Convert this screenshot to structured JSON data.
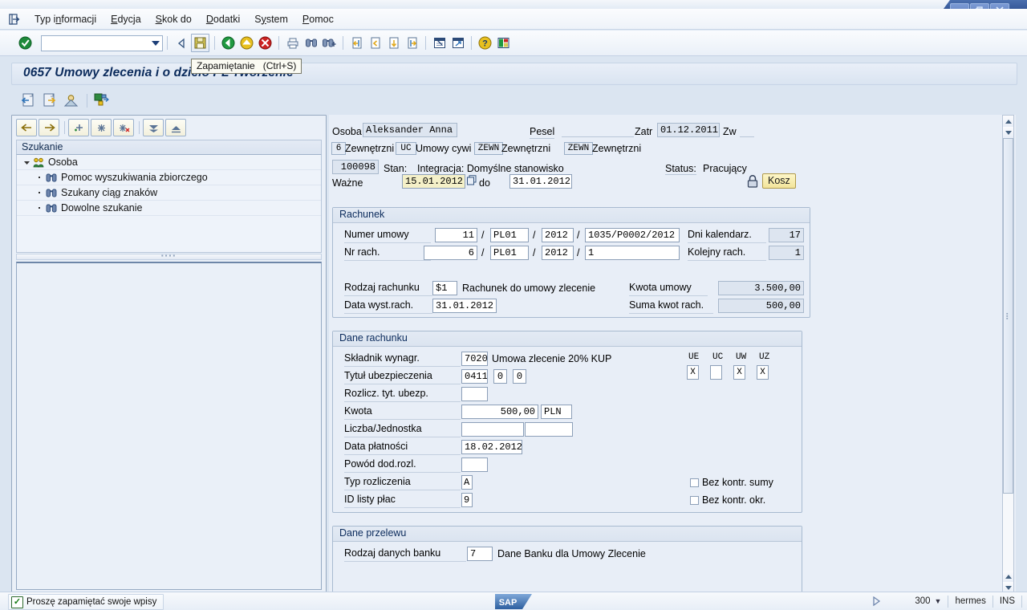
{
  "window": {
    "buttons": [
      "minimize",
      "maximize",
      "close"
    ]
  },
  "menubar": {
    "back_icon": "exit-arrow-icon",
    "items": [
      {
        "label": "Typ informacji",
        "accel_index": 5
      },
      {
        "label": "Edycja",
        "accel_index": 0
      },
      {
        "label": "Skok do",
        "accel_index": 0
      },
      {
        "label": "Dodatki",
        "accel_index": 0
      },
      {
        "label": "System",
        "accel_index": 1
      },
      {
        "label": "Pomoc",
        "accel_index": 0
      }
    ]
  },
  "toolbar": {
    "command_field_value": "",
    "icons": [
      "enter-check-icon",
      "back-triangle-icon",
      "save-icon",
      "back-green-icon",
      "exit-yellow-icon",
      "cancel-red-icon",
      "print-icon",
      "find-icon",
      "find-next-icon",
      "first-page-icon",
      "previous-page-icon",
      "next-page-icon",
      "last-page-icon",
      "new-session-icon",
      "create-shortcut-icon",
      "help-icon",
      "customize-layout-icon"
    ]
  },
  "tooltip": {
    "text": "Zapamiętanie   (Ctrl+S)"
  },
  "title_strip": {
    "text": "0657 Umowy zlecenia i o dzieło PL Tworzenie"
  },
  "app_toolbar": {
    "icons": [
      "previous-record-icon",
      "next-record-icon",
      "person-photo-icon",
      "org-assignment-icon"
    ]
  },
  "tree_panel": {
    "toolbar_icons": [
      "back-arrow-icon",
      "forward-arrow-icon",
      "add-node-icon",
      "expand-node-icon",
      "delete-node-icon",
      "expand-all-icon",
      "collapse-all-icon"
    ],
    "header": "Szukanie",
    "nodes": [
      {
        "label": "Osoba",
        "icon": "people-group-icon",
        "level": 0,
        "expanded": true
      },
      {
        "label": "Pomoc wyszukiwania zbiorczego",
        "icon": "binoculars-icon",
        "level": 1
      },
      {
        "label": "Szukany ciąg znaków",
        "icon": "binoculars-icon",
        "level": 1
      },
      {
        "label": "Dowolne szukanie",
        "icon": "binoculars-icon",
        "level": 1
      }
    ]
  },
  "header": {
    "osoba_label": "Osoba",
    "osoba_value": "Aleksander Anna",
    "pesel_label": "Pesel",
    "pesel_value": "",
    "zatr_label": "Zatr",
    "zatr_value": "01.12.2011",
    "zw_label": "Zw",
    "zw_value": "",
    "row2": {
      "code1": "6",
      "text1": "Zewnętrzni",
      "code2": "UC",
      "text2": "Umowy cywi",
      "code3": "ZEWN",
      "text3": "Zewnętrzni",
      "code4": "ZEWN",
      "text4": "Zewnętrzni"
    },
    "row3": {
      "personnel_no": "100098",
      "stan_label": "Stan:",
      "stan_value": "Integracja: Domyślne stanowisko",
      "status_label": "Status:",
      "status_value": "Pracujący"
    },
    "valid": {
      "label": "Ważne",
      "from": "15.01.2012",
      "to_label": "do",
      "to": "31.01.2012",
      "match_icon": "matchcode-icon",
      "lock_icon": "lock-icon",
      "delete_button": "Kosz"
    }
  },
  "rachunek": {
    "title": "Rachunek",
    "numer_umowy_label": "Numer umowy",
    "numer_umowy_1": "11",
    "numer_umowy_2": "PL01",
    "numer_umowy_3": "2012",
    "numer_umowy_4": "1035/P0002/2012",
    "dni_kalendarz_label": "Dni kalendarz.",
    "dni_kalendarz_value": "17",
    "nr_rach_label": "Nr rach.",
    "nr_rach_1": "6",
    "nr_rach_2": "PL01",
    "nr_rach_3": "2012",
    "nr_rach_4": "1",
    "kolejny_rach_label": "Kolejny rach.",
    "kolejny_rach_value": "1",
    "rodzaj_label": "Rodzaj rachunku",
    "rodzaj_value": "$1",
    "rodzaj_text": "Rachunek do  umowy zlecenie",
    "kwota_umowy_label": "Kwota umowy",
    "kwota_umowy_value": "3.500,00",
    "data_wyst_label": "Data wyst.rach.",
    "data_wyst_value": "31.01.2012",
    "suma_kwot_label": "Suma kwot rach.",
    "suma_kwot_value": "500,00",
    "separator": "/"
  },
  "dane_rachunku": {
    "title": "Dane rachunku",
    "skladnik_label": "Składnik wynagr.",
    "skladnik_value": "7020",
    "skladnik_text": "Umowa zlecenie 20% KUP",
    "tytul_label": "Tytuł ubezpieczenia",
    "tytul_value": "0411",
    "tytul_sub1": "0",
    "tytul_sub2": "0",
    "rozlicz_label": "Rozlicz. tyt. ubezp.",
    "rozlicz_value": "",
    "kwota_label": "Kwota",
    "kwota_value": "500,00",
    "kwota_currency": "PLN",
    "liczba_label": "Liczba/Jednostka",
    "liczba_value": "",
    "jednostka_value": "",
    "data_platnosci_label": "Data płatności",
    "data_platnosci_value": "18.02.2012",
    "powod_label": "Powód dod.rozl.",
    "powod_value": "",
    "typ_rozliczenia_label": "Typ rozliczenia",
    "typ_rozliczenia_value": "A",
    "id_listy_label": "ID listy płac",
    "id_listy_value": "9",
    "flags_headers": [
      "UE",
      "UC",
      "UW",
      "UZ"
    ],
    "flags_values": [
      "X",
      "",
      "X",
      "X"
    ],
    "checkboxes": [
      {
        "label": "Bez kontr. sumy",
        "checked": false
      },
      {
        "label": "Bez kontr. okr.",
        "checked": false
      }
    ]
  },
  "dane_przelewu": {
    "title": "Dane przelewu",
    "rodzaj_label": "Rodzaj danych banku",
    "rodzaj_value": "7",
    "rodzaj_text": "Dane Banku dla Umowy Zlecenie"
  },
  "statusbar": {
    "message": "Proszę zapamiętać swoje wpisy",
    "ok_icon": "status-ok-icon",
    "logo": "SAP",
    "expand_icon": "expand-status-icon",
    "system": "300",
    "server": "hermes",
    "mode": "INS"
  }
}
